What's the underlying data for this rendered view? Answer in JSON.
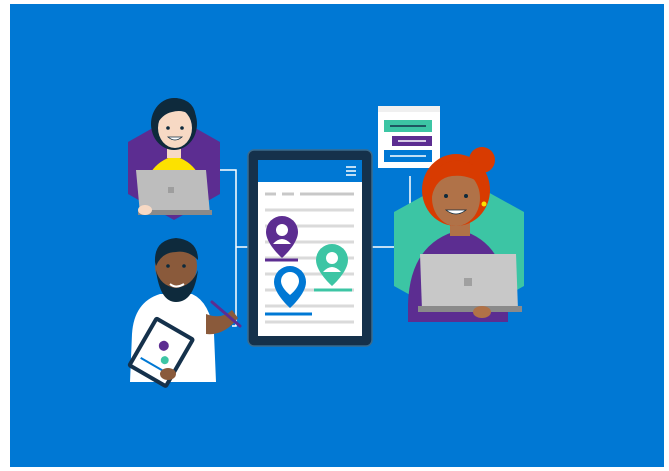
{
  "illustration": {
    "background_color": "#0078D4",
    "accent_colors": {
      "purple": "#5C2D91",
      "teal": "#3CC5A4",
      "blue": "#0078D4",
      "yellow": "#FCE100",
      "red_hair": "#D83B01",
      "device_frame": "#15314B",
      "laptop_gray": "#C8C8C8"
    },
    "people": [
      {
        "name": "woman-yellow-shirt",
        "device": "laptop",
        "badge_color": "#5C2D91"
      },
      {
        "name": "man-with-tablet",
        "device": "tablet",
        "badge_color": "none"
      },
      {
        "name": "woman-red-hair",
        "device": "laptop",
        "badge_color": "#3CC5A4"
      }
    ],
    "center_device": {
      "type": "tablet",
      "header_icon": "hamburger-menu-icon",
      "pins": [
        "purple-pin",
        "teal-pin",
        "blue-pin"
      ]
    },
    "popup_card": {
      "bars": [
        "teal-bar",
        "purple-bar",
        "blue-bar"
      ]
    }
  }
}
